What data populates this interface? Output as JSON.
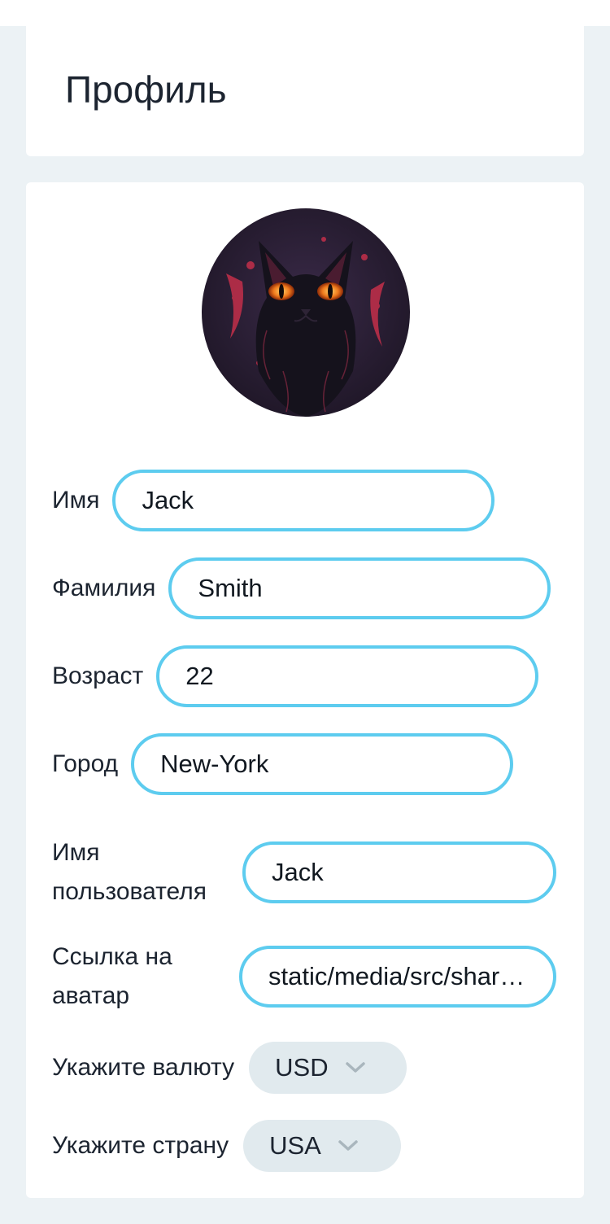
{
  "header": {
    "title": "Профиль"
  },
  "profile": {
    "avatar_alt": "avatar",
    "fields": {
      "first_name": {
        "label": "Имя",
        "value": "Jack"
      },
      "last_name": {
        "label": "Фамилия",
        "value": "Smith"
      },
      "age": {
        "label": "Возраст",
        "value": "22"
      },
      "city": {
        "label": "Город",
        "value": "New-York"
      },
      "username": {
        "label": "Имя пользователя",
        "value": "Jack"
      },
      "avatar_link": {
        "label": "Ссылка на аватар",
        "value": "static/media/src/shared/assets/tests/storybook.jpg"
      }
    },
    "currency": {
      "label": "Укажите валюту",
      "value": "USD",
      "icon": "chevron-down-icon"
    },
    "country": {
      "label": "Укажите страну",
      "value": "USA",
      "icon": "chevron-down-icon"
    }
  },
  "colors": {
    "input_border": "#5dccef",
    "select_bg": "#e1eaee",
    "page_bg": "#ecf2f5",
    "text": "#1c2430"
  }
}
